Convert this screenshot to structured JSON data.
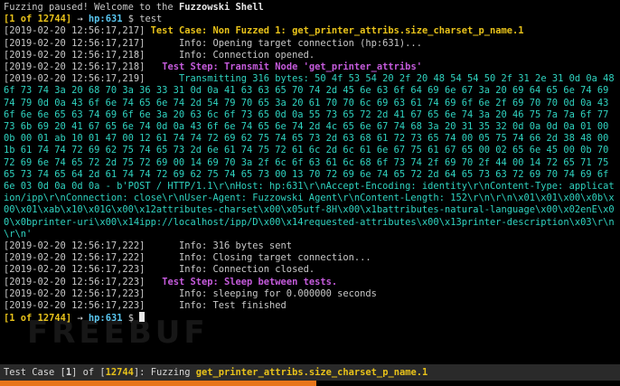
{
  "header": {
    "welcome": "Fuzzing paused! Welcome to the ",
    "shell_name": "Fuzzowski Shell"
  },
  "prompt": {
    "index": "1",
    "total": "12744",
    "of_word": "of",
    "host": "hp:631",
    "arrow": "→",
    "symbol": "$",
    "command": "test"
  },
  "log": {
    "l1_ts": "[2019-02-20 12:56:17,217]",
    "l1_text": "Test Case: Non Fuzzed 1: get_printer_attribs.size_charset_p_name.1",
    "l2_ts": "[2019-02-20 12:56:17,217]",
    "l2_text": "Info: Opening target connection (hp:631)...",
    "l3_ts": "[2019-02-20 12:56:17,218]",
    "l3_text": "Info: Connection opened.",
    "l4_ts": "[2019-02-20 12:56:17,218]",
    "l4_text": "Test Step: Transmit Node 'get_printer_attribs'",
    "l5_ts": "[2019-02-20 12:56:17,219]",
    "transmit_block": "Transmitting 316 bytes: 50 4f 53 54 20 2f 20 48 54 54 50 2f 31 2e 31 0d 0a 48 6f 73 74 3a 20 68 70 3a 36 33 31 0d 0a 41 63 63 65 70 74 2d 45 6e 63 6f 64 69 6e 67 3a 20 69 64 65 6e 74 69 74 79 0d 0a 43 6f 6e 74 65 6e 74 2d 54 79 70 65 3a 20 61 70 70 6c 69 63 61 74 69 6f 6e 2f 69 70 70 0d 0a 43 6f 6e 6e 65 63 74 69 6f 6e 3a 20 63 6c 6f 73 65 0d 0a 55 73 65 72 2d 41 67 65 6e 74 3a 20 46 75 7a 7a 6f 77 73 6b 69 20 41 67 65 6e 74 0d 0a 43 6f 6e 74 65 6e 74 2d 4c 65 6e 67 74 68 3a 20 31 35 32 0d 0a 0d 0a 01 00 0b 00 01 ab 10 01 47 00 12 61 74 74 72 69 62 75 74 65 73 2d 63 68 61 72 73 65 74 00 05 75 74 66 2d 38 48 00 1b 61 74 74 72 69 62 75 74 65 73 2d 6e 61 74 75 72 61 6c 2d 6c 61 6e 67 75 61 67 65 00 02 65 6e 45 00 0b 70 72 69 6e 74 65 72 2d 75 72 69 00 14 69 70 3a 2f 6c 6f 63 61 6c 68 6f 73 74 2f 69 70 2f 44 00 14 72 65 71 75 65 73 74 65 64 2d 61 74 74 72 69 62 75 74 65 73 00 13 70 72 69 6e 74 65 72 2d 64 65 73 63 72 69 70 74 69 6f 6e 03 0d 0a 0d 0a - b'POST / HTTP/1.1\\r\\nHost: hp:631\\r\\nAccept-Encoding: identity\\r\\nContent-Type: application/ipp\\r\\nConnection: close\\r\\nUser-Agent: Fuzzowski Agent\\r\\nContent-Length: 152\\r\\n\\r\\n\\x01\\x01\\x00\\x0b\\x00\\x01\\xab\\x10\\x01G\\x00\\x12attributes-charset\\x00\\x05utf-8H\\x00\\x1battributes-natural-language\\x00\\x02enE\\x00\\x0bprinter-uri\\x00\\x14ipp://localhost/ipp/D\\x00\\x14requested-attributes\\x00\\x13printer-description\\x03\\r\\n\\r\\n'",
    "l6_ts": "[2019-02-20 12:56:17,222]",
    "l6_text": "Info: 316 bytes sent",
    "l7_ts": "[2019-02-20 12:56:17,222]",
    "l7_text": "Info: Closing target connection...",
    "l8_ts": "[2019-02-20 12:56:17,223]",
    "l8_text": "Info: Connection closed.",
    "l9_ts": "[2019-02-20 12:56:17,223]",
    "l9_text": "Test Step: Sleep between tests.",
    "l10_ts": "[2019-02-20 12:56:17,223]",
    "l10_text": "Info: sleeping for 0.000000 seconds",
    "l11_ts": "[2019-02-20 12:56:17,223]",
    "l11_text": "Info: Test finished"
  },
  "watermark": "FREEBUF",
  "status": {
    "prefix": "Test Case [",
    "index": "1",
    "mid": "] of [",
    "total": "12744",
    "suffix": "]: Fuzzing ",
    "case_name": "get_printer_attribs.size_charset_p_name.1",
    "progress": 0.51
  },
  "colors": {
    "background": "#000000",
    "hex_cyan": "#2fd3c0",
    "test_case_yellow": "#e8c21a",
    "test_step_magenta": "#c55bdc",
    "host_cyan": "#58c6f0",
    "status_bar_orange": "#e8751a"
  }
}
